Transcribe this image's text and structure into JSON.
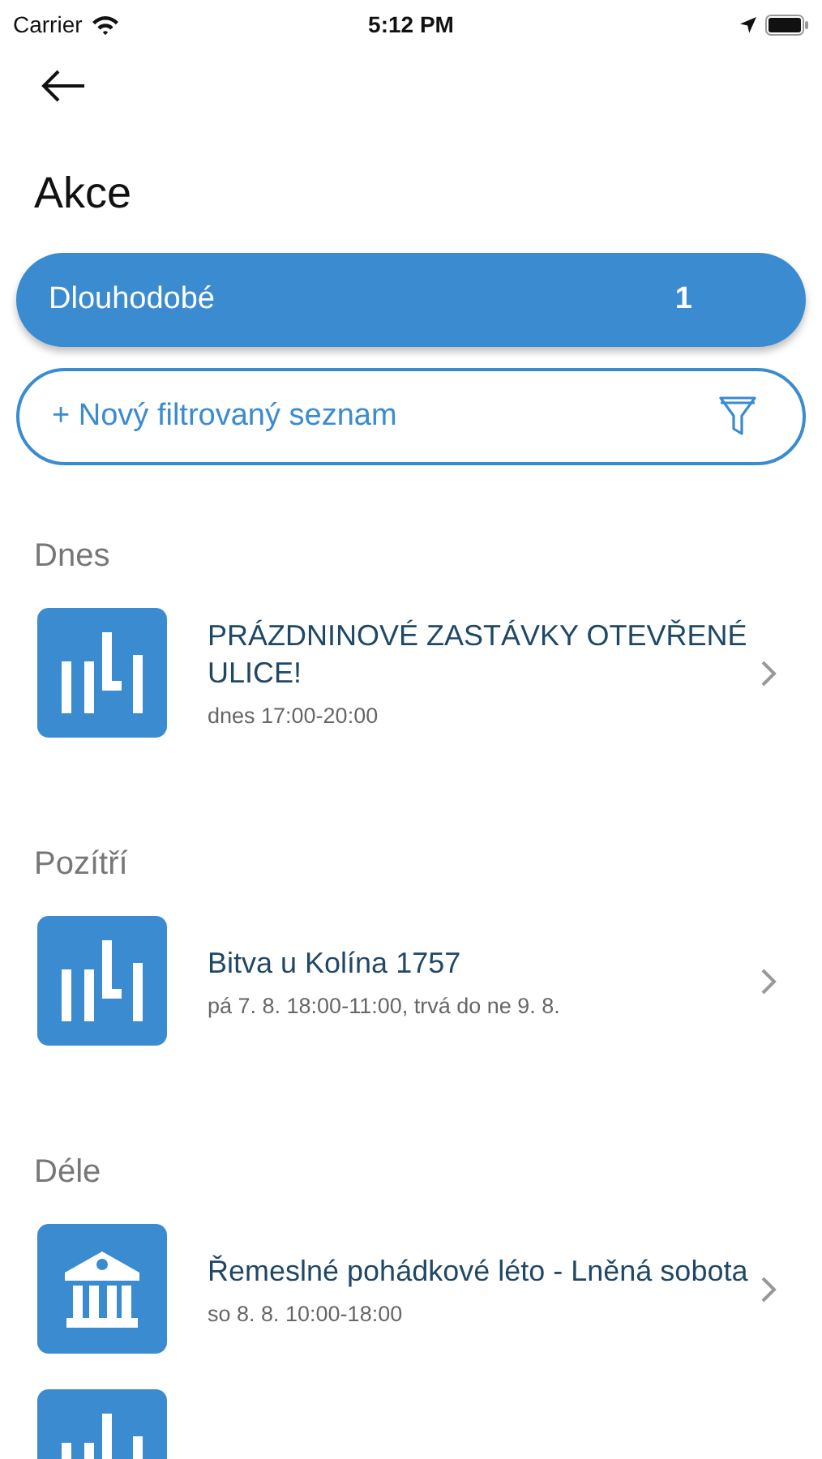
{
  "status_bar": {
    "carrier": "Carrier",
    "time": "5:12 PM"
  },
  "title": "Akce",
  "saved_list": {
    "label": "Dlouhodobé",
    "count": "1"
  },
  "new_list_button": {
    "label": "+ Nový filtrovaný seznam"
  },
  "sections": [
    {
      "heading": "Dnes",
      "events": [
        {
          "kind": "bars",
          "title": "PRÁZDNINOVÉ ZASTÁVKY OTEVŘENÉ ULICE!",
          "time": "dnes 17:00-20:00"
        }
      ]
    },
    {
      "heading": "Pozítří",
      "events": [
        {
          "kind": "bars",
          "title": "Bitva u Kolína 1757",
          "time": "pá 7. 8. 18:00-11:00, trvá do ne 9. 8."
        }
      ]
    },
    {
      "heading": "Déle",
      "events": [
        {
          "kind": "museum",
          "title": "Řemeslné pohádkové léto - Lněná sobota",
          "time": "so 8. 8. 10:00-18:00"
        },
        {
          "kind": "bars"
        }
      ]
    }
  ]
}
